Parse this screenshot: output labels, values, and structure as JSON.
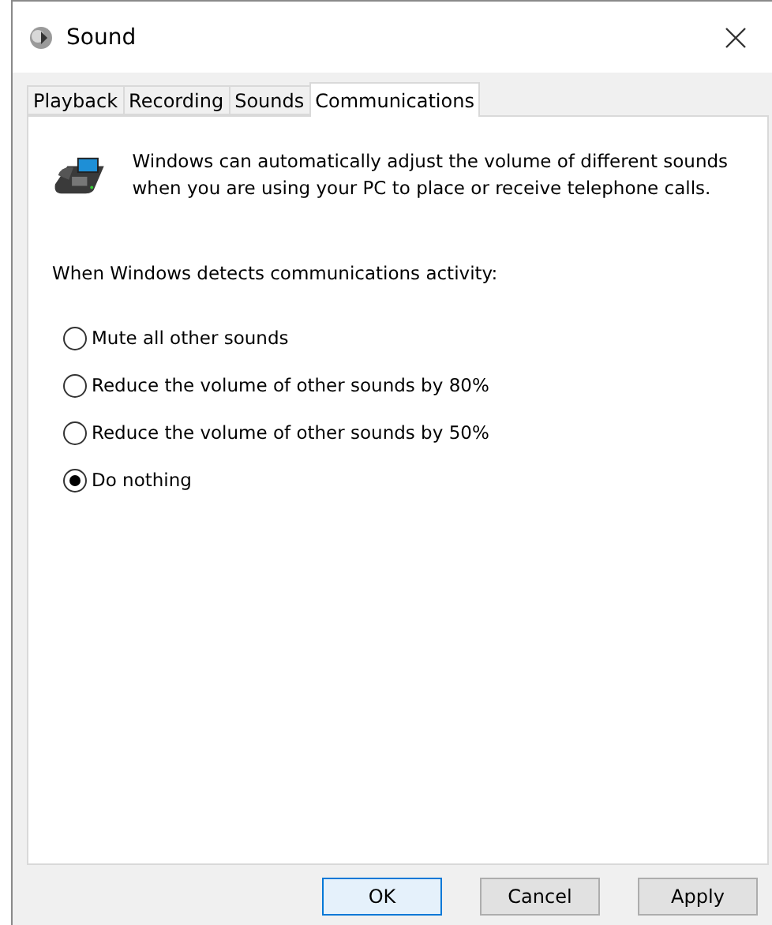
{
  "window": {
    "title": "Sound"
  },
  "tabs": [
    {
      "label": "Playback",
      "selected": false
    },
    {
      "label": "Recording",
      "selected": false
    },
    {
      "label": "Sounds",
      "selected": false
    },
    {
      "label": "Communications",
      "selected": true
    }
  ],
  "intro": "Windows can automatically adjust the volume of different sounds when you are using your PC to place or receive telephone calls.",
  "prompt": "When Windows detects communications activity:",
  "options": [
    {
      "label": "Mute all other sounds",
      "selected": false
    },
    {
      "label": "Reduce the volume of other sounds by 80%",
      "selected": false
    },
    {
      "label": "Reduce the volume of other sounds by 50%",
      "selected": false
    },
    {
      "label": "Do nothing",
      "selected": true
    }
  ],
  "buttons": [
    {
      "label": "OK",
      "default": true
    },
    {
      "label": "Cancel",
      "default": false
    },
    {
      "label": "Apply",
      "default": false
    }
  ]
}
